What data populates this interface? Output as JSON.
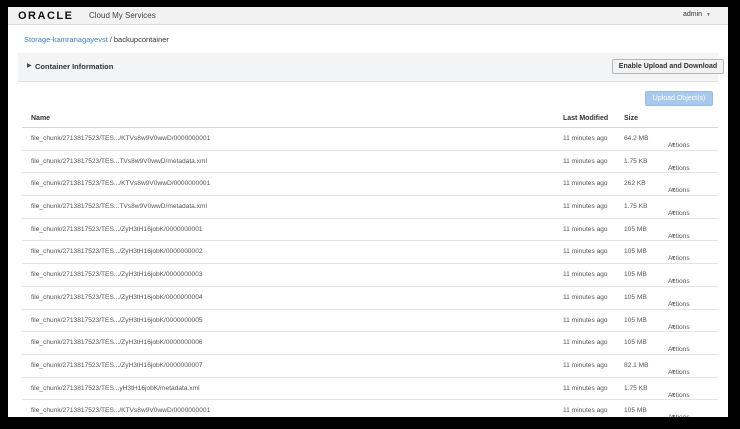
{
  "header": {
    "logo": "ORACLE",
    "app_name": "Cloud My Services",
    "user": "admin"
  },
  "breadcrumb": {
    "link": "Storage-kamranagayevst",
    "separator": "/",
    "current": "backupcontainer"
  },
  "container_panel": {
    "title": "Container Information",
    "enable_button": "Enable Upload and Download"
  },
  "upload_button": "Upload Object(s)",
  "table": {
    "columns": {
      "name": "Name",
      "modified": "Last Modified",
      "size": "Size"
    },
    "action_label": "Actions",
    "rows": [
      {
        "name": "file_chunk/2713817523/TES.../KTVs8w9V0wwD/0000000001",
        "modified": "11 minutes ago",
        "size": "64.2 MB"
      },
      {
        "name": "file_chunk/2713817523/TES...TVs8w9V0wwD/metadata.xml",
        "modified": "11 minutes ago",
        "size": "1.75 KB"
      },
      {
        "name": "file_chunk/2713817523/TES.../KTVs8w9V0wwD/0000000001",
        "modified": "11 minutes ago",
        "size": "262 KB"
      },
      {
        "name": "file_chunk/2713817523/TES...TVs8w9V0wwD/metadata.xml",
        "modified": "11 minutes ago",
        "size": "1.75 KB"
      },
      {
        "name": "file_chunk/2713817523/TES.../ZyH3tH16jobK/0000000001",
        "modified": "11 minutes ago",
        "size": "105 MB"
      },
      {
        "name": "file_chunk/2713817523/TES.../ZyH3tH16jobK/0000000002",
        "modified": "11 minutes ago",
        "size": "105 MB"
      },
      {
        "name": "file_chunk/2713817523/TES.../ZyH3tH16jobK/0000000003",
        "modified": "11 minutes ago",
        "size": "105 MB"
      },
      {
        "name": "file_chunk/2713817523/TES.../ZyH3tH16jobK/0000000004",
        "modified": "11 minutes ago",
        "size": "105 MB"
      },
      {
        "name": "file_chunk/2713817523/TES.../ZyH3tH16jobK/0000000005",
        "modified": "11 minutes ago",
        "size": "105 MB"
      },
      {
        "name": "file_chunk/2713817523/TES.../ZyH3tH16jobK/0000000006",
        "modified": "11 minutes ago",
        "size": "105 MB"
      },
      {
        "name": "file_chunk/2713817523/TES.../ZyH3tH16jobK/0000000007",
        "modified": "11 minutes ago",
        "size": "82.1 MB"
      },
      {
        "name": "file_chunk/2713817523/TES...yH3tH16jobK/metadata.xml",
        "modified": "11 minutes ago",
        "size": "1.75 KB"
      },
      {
        "name": "file_chunk/2713817523/TES.../KTVs8w9V0wwD/0000000001",
        "modified": "11 minutes ago",
        "size": "105 MB"
      }
    ]
  }
}
